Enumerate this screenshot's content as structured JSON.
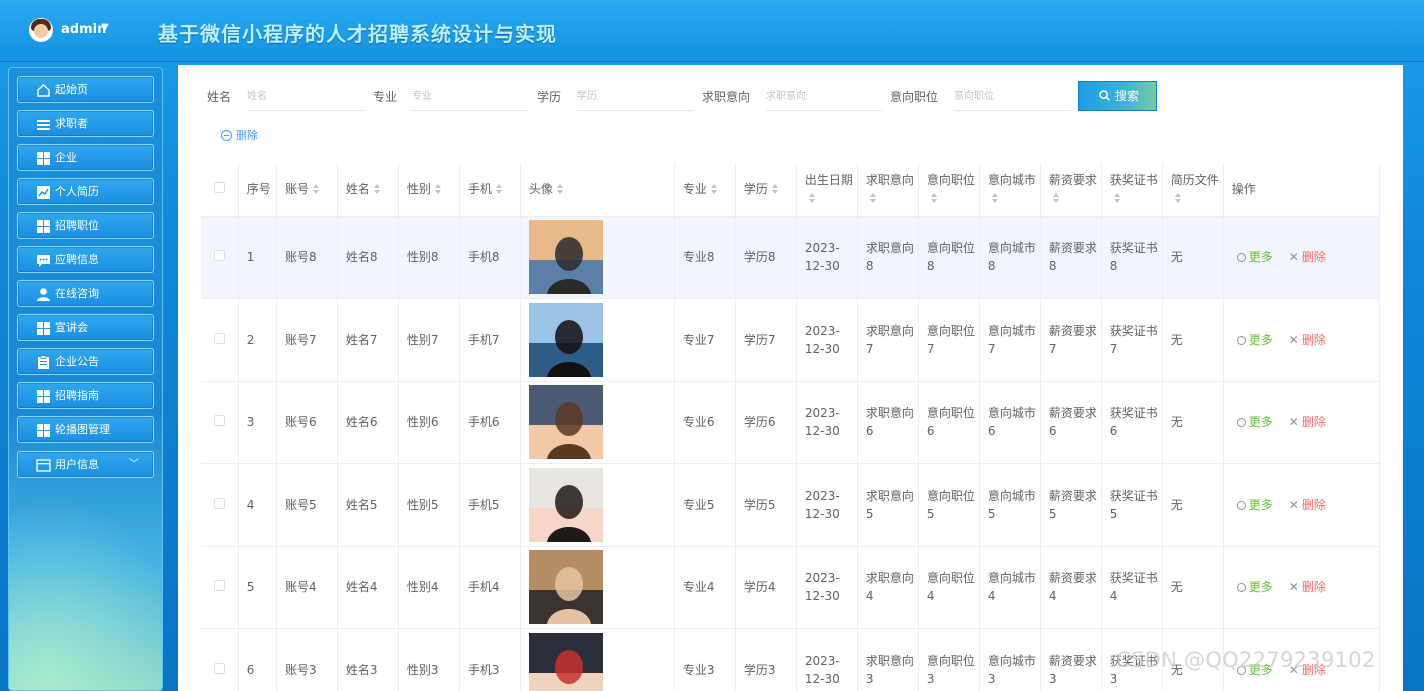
{
  "header": {
    "user": "admin",
    "title": "基于微信小程序的人才招聘系统设计与实现"
  },
  "sidebar": {
    "items": [
      {
        "label": "起始页",
        "icon": "home-icon"
      },
      {
        "label": "求职者",
        "icon": "list-icon"
      },
      {
        "label": "企业",
        "icon": "grid-icon"
      },
      {
        "label": "个人简历",
        "icon": "chart-icon"
      },
      {
        "label": "招聘职位",
        "icon": "grid-icon"
      },
      {
        "label": "应聘信息",
        "icon": "message-icon"
      },
      {
        "label": "在线咨询",
        "icon": "user-icon"
      },
      {
        "label": "宣讲会",
        "icon": "grid-icon"
      },
      {
        "label": "企业公告",
        "icon": "clipboard-icon"
      },
      {
        "label": "招聘指南",
        "icon": "grid-icon"
      },
      {
        "label": "轮播图管理",
        "icon": "grid-icon"
      },
      {
        "label": "用户信息",
        "icon": "card-icon"
      }
    ]
  },
  "search": {
    "fields": [
      {
        "label": "姓名",
        "placeholder": "姓名"
      },
      {
        "label": "专业",
        "placeholder": "专业"
      },
      {
        "label": "学历",
        "placeholder": "学历"
      },
      {
        "label": "求职意向",
        "placeholder": "求职意向"
      },
      {
        "label": "意向职位",
        "placeholder": "意向职位"
      }
    ],
    "button": "搜索",
    "delete_button": "删除"
  },
  "table": {
    "headers": [
      "序号",
      "账号",
      "姓名",
      "性别",
      "手机",
      "头像",
      "专业",
      "学历",
      "出生日期",
      "求职意向",
      "意向职位",
      "意向城市",
      "薪资要求",
      "获奖证书",
      "简历文件",
      "操作"
    ],
    "more_label": "更多",
    "delete_label": "删除",
    "rows": [
      {
        "idx": "1",
        "account": "账号8",
        "name": "姓名8",
        "gender": "性别8",
        "phone": "手机8",
        "major": "专业8",
        "edu": "学历8",
        "birth": "2023-12-30",
        "intent": "求职意向8",
        "position": "意向职位8",
        "city": "意向城市8",
        "salary": "薪资要求8",
        "award": "获奖证书8",
        "resume": "无",
        "avatar_colors": [
          "#e9b98a",
          "#5b7fa6",
          "#2a2a2a"
        ]
      },
      {
        "idx": "2",
        "account": "账号7",
        "name": "姓名7",
        "gender": "性别7",
        "phone": "手机7",
        "major": "专业7",
        "edu": "学历7",
        "birth": "2023-12-30",
        "intent": "求职意向7",
        "position": "意向职位7",
        "city": "意向城市7",
        "salary": "薪资要求7",
        "award": "获奖证书7",
        "resume": "无",
        "avatar_colors": [
          "#9cc3e6",
          "#2e5c86",
          "#111111"
        ]
      },
      {
        "idx": "3",
        "account": "账号6",
        "name": "姓名6",
        "gender": "性别6",
        "phone": "手机6",
        "major": "专业6",
        "edu": "学历6",
        "birth": "2023-12-30",
        "intent": "求职意向6",
        "position": "意向职位6",
        "city": "意向城市6",
        "salary": "薪资要求6",
        "award": "获奖证书6",
        "resume": "无",
        "avatar_colors": [
          "#4b5a72",
          "#f2c9a6",
          "#5a3a22"
        ]
      },
      {
        "idx": "4",
        "account": "账号5",
        "name": "姓名5",
        "gender": "性别5",
        "phone": "手机5",
        "major": "专业5",
        "edu": "学历5",
        "birth": "2023-12-30",
        "intent": "求职意向5",
        "position": "意向职位5",
        "city": "意向城市5",
        "salary": "薪资要求5",
        "award": "获奖证书5",
        "resume": "无",
        "avatar_colors": [
          "#e8e4e0",
          "#f5d6c8",
          "#1e1a18"
        ]
      },
      {
        "idx": "5",
        "account": "账号4",
        "name": "姓名4",
        "gender": "性别4",
        "phone": "手机4",
        "major": "专业4",
        "edu": "学历4",
        "birth": "2023-12-30",
        "intent": "求职意向4",
        "position": "意向职位4",
        "city": "意向城市4",
        "salary": "薪资要求4",
        "award": "获奖证书4",
        "resume": "无",
        "avatar_colors": [
          "#b58d62",
          "#3a3430",
          "#e6c3a0"
        ]
      },
      {
        "idx": "6",
        "account": "账号3",
        "name": "姓名3",
        "gender": "性别3",
        "phone": "手机3",
        "major": "专业3",
        "edu": "学历3",
        "birth": "2023-12-30",
        "intent": "求职意向3",
        "position": "意向职位3",
        "city": "意向城市3",
        "salary": "薪资要求3",
        "award": "获奖证书3",
        "resume": "无",
        "avatar_colors": [
          "#2c2f3a",
          "#f0d3bf",
          "#c53030"
        ]
      }
    ]
  },
  "watermark": "CSDN @QQ2279239102"
}
